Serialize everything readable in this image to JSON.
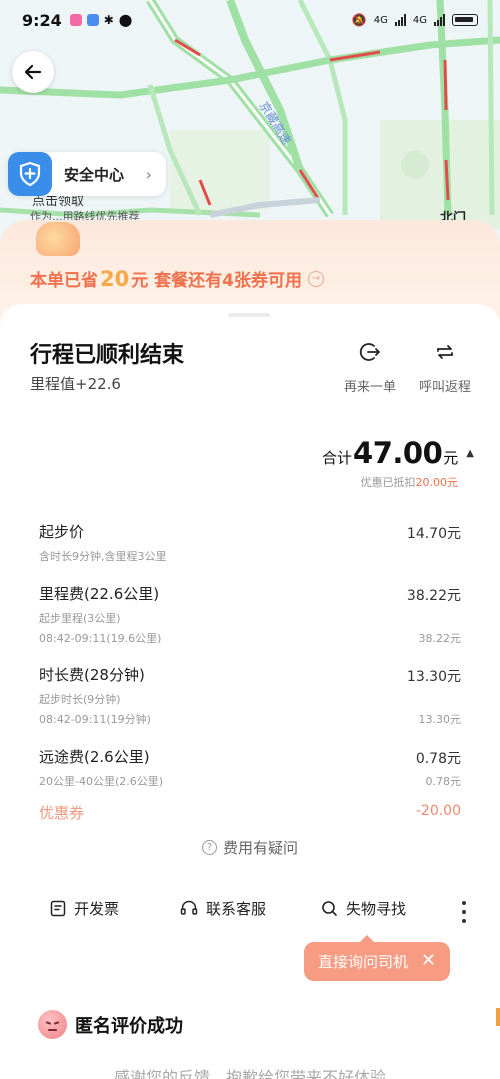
{
  "status_bar": {
    "time": "9:24",
    "network_1": "4G",
    "network_2": "4G"
  },
  "map": {
    "road_label": "京藏高速",
    "place_label": "点击领取",
    "place_sub": "作为...用路线优先推荐",
    "gate_label": "北门"
  },
  "safety": {
    "label": "安全中心"
  },
  "promo": {
    "prefix": "本单已省",
    "amount": "20",
    "suffix": "元 套餐还有4张券可用"
  },
  "trip": {
    "title": "行程已顺利结束",
    "mileage": "里程值+22.6",
    "action_again": "再来一单",
    "action_return": "呼叫返程"
  },
  "total": {
    "prefix": "合计",
    "amount": "47.00",
    "unit": "元",
    "discount_prefix": "优惠已抵扣",
    "discount_amount": "20.00",
    "discount_unit": "元"
  },
  "fees": [
    {
      "name": "起步价",
      "amount": "14.70元",
      "details": [
        {
          "text": "含时长9分钟,含里程3公里",
          "amount": ""
        }
      ]
    },
    {
      "name": "里程费(22.6公里)",
      "amount": "38.22元",
      "details": [
        {
          "text": "起步里程(3公里)",
          "amount": ""
        },
        {
          "text": "08:42-09:11(19.6公里)",
          "amount": "38.22元"
        }
      ]
    },
    {
      "name": "时长费(28分钟)",
      "amount": "13.30元",
      "details": [
        {
          "text": "起步时长(9分钟)",
          "amount": ""
        },
        {
          "text": "08:42-09:11(19分钟)",
          "amount": "13.30元"
        }
      ]
    },
    {
      "name": "远途费(2.6公里)",
      "amount": "0.78元",
      "details": [
        {
          "text": "20公里-40公里(2.6公里)",
          "amount": "0.78元"
        }
      ]
    }
  ],
  "coupon": {
    "name": "优惠券",
    "amount": "-20.00"
  },
  "question": {
    "label": "费用有疑问"
  },
  "bottom_actions": {
    "invoice": "开发票",
    "support": "联系客服",
    "lost": "失物寻找"
  },
  "tooltip": {
    "label": "直接询问司机"
  },
  "rating": {
    "label": "匿名评价成功",
    "thanks": "感谢您的反馈，抱歉给您带来不好体验"
  },
  "colors": {
    "accent": "#f0704d",
    "tooltip": "#f79b83",
    "shield": "#3a8de8"
  }
}
